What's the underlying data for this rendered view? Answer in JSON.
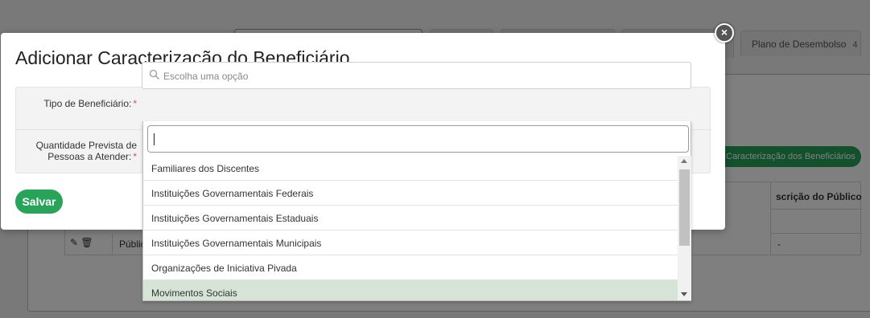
{
  "background": {
    "tab_plano": {
      "label": "Plano de Desembolso",
      "count": "4"
    },
    "add_button": "Caracterização dos Beneficiários",
    "table": {
      "header_descricao": "scrição do Público-Alvo",
      "row_cell_publico": "Públic",
      "row_cell_dash": "-"
    }
  },
  "modal": {
    "title": "Adicionar Caracterização do Beneficiário",
    "close_label": "×",
    "fields": {
      "tipo_label": "Tipo de Beneficiário:",
      "qtd_label_line1": "Quantidade Prevista de",
      "qtd_label_line2": "Pessoas a Atender:",
      "required_mark": "*"
    },
    "select": {
      "placeholder": "Escolha uma opção",
      "search_value": "",
      "options": [
        "Familiares dos Discentes",
        "Instituições Governamentais Federais",
        "Instituições Governamentais Estaduais",
        "Instituições Governamentais Municipais",
        "Organizações de Iniciativa Pivada",
        "Movimentos Sociais"
      ],
      "highlighted_index": 5
    },
    "save_label": "Salvar"
  },
  "colors": {
    "accent_green": "#27a35a",
    "highlight_row": "#d6e4d8",
    "required_red": "#d9534f"
  }
}
